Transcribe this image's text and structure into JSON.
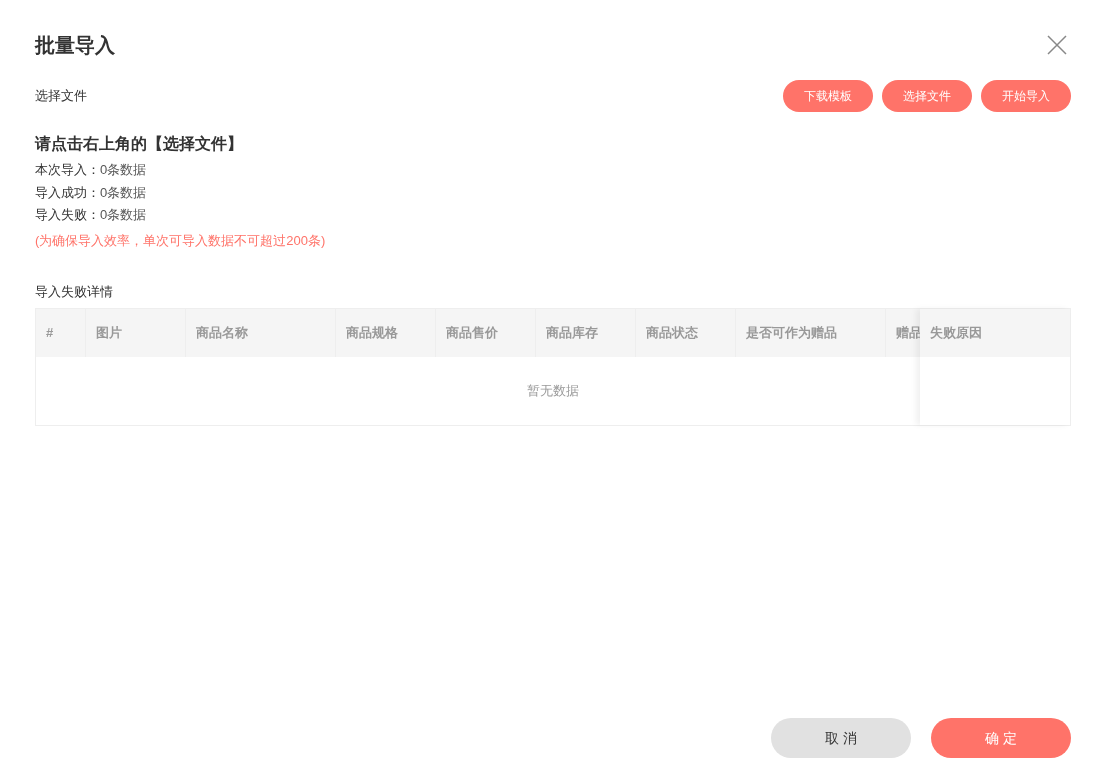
{
  "dialog": {
    "title": "批量导入"
  },
  "file_section": {
    "label": "选择文件",
    "buttons": [
      "下载模板",
      "选择文件",
      "开始导入"
    ]
  },
  "hint": "请点击右上角的【选择文件】",
  "stats": [
    {
      "label": "本次导入：",
      "value": "0条数据"
    },
    {
      "label": "导入成功：",
      "value": "0条数据"
    },
    {
      "label": "导入失败：",
      "value": "0条数据"
    }
  ],
  "warning": "(为确保导入效率，单次可导入数据不可超过200条)",
  "table": {
    "title": "导入失败详情",
    "columns": [
      "#",
      "图片",
      "商品名称",
      "商品规格",
      "商品售价",
      "商品库存",
      "商品状态",
      "是否可作为赠品",
      "赠品"
    ],
    "fixed_column": "失败原因",
    "empty_text": "暂无数据"
  },
  "footer": {
    "buttons": [
      {
        "label": "取 消",
        "kind": "secondary"
      },
      {
        "label": "确 定",
        "kind": "primary"
      }
    ]
  }
}
